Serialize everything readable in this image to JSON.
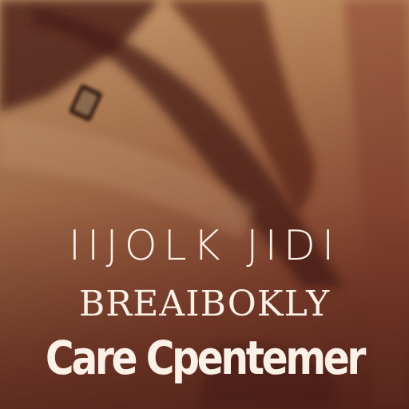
{
  "poster": {
    "line_1": "IIJOLK JIDI",
    "line_2": "BREAIBOKLY",
    "line_3": "Care Cpentemer"
  },
  "colors": {
    "background_light": "#c79a6e",
    "background_dark": "#6e2f22",
    "shadow": "#4a1f18",
    "text": "#fbf1e6"
  }
}
